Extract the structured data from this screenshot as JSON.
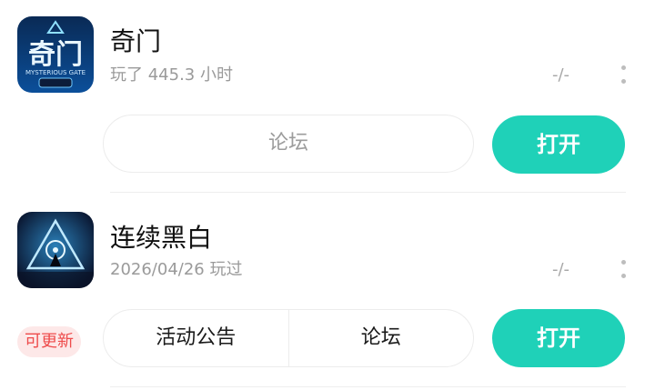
{
  "games": [
    {
      "title": "奇门",
      "subtitle": "玩了 445.3 小时",
      "score": "-/-",
      "icon": "mysterious-gate-icon",
      "links": [
        "论坛"
      ],
      "open_label": "打开"
    },
    {
      "title": "连续黑白",
      "subtitle": "2026/04/26 玩过",
      "score": "-/-",
      "icon": "triangle-eye-icon",
      "update_badge": "可更新",
      "links": [
        "活动公告",
        "论坛"
      ],
      "open_label": "打开"
    }
  ],
  "colors": {
    "accent": "#1fd1b8",
    "badge_bg": "#fde8e8",
    "badge_text": "#ee4b4b"
  }
}
